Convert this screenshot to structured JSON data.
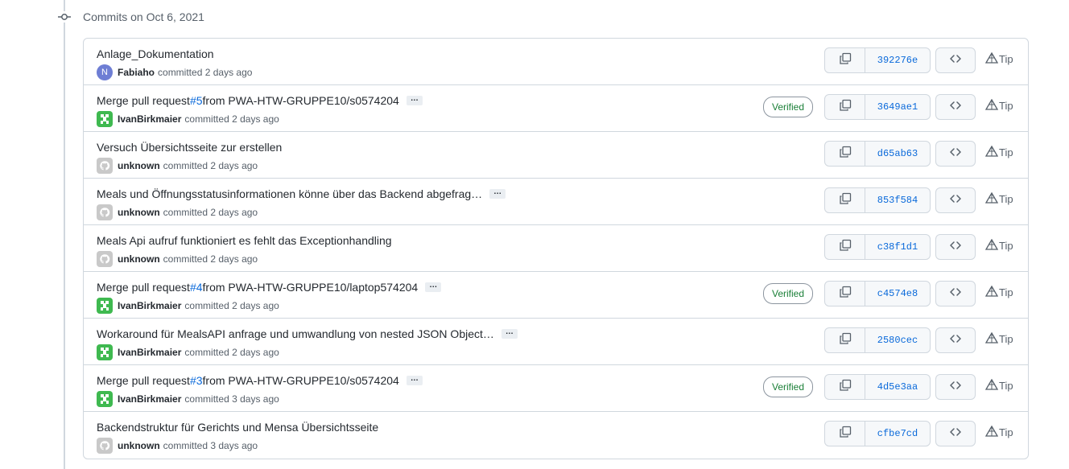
{
  "day_header": "Commits on Oct 6, 2021",
  "tip_label": "Tip",
  "verified_label": "Verified",
  "committed_word": "committed",
  "colors": {
    "link": "#0969da",
    "verified": "#1a7f37",
    "border": "#d0d7de"
  },
  "commits": [
    {
      "title": "Anlage_Dokumentation",
      "pr": null,
      "suffix": "",
      "more": false,
      "author": "Fabiaho",
      "avatar": "letter",
      "avatar_letter": "N",
      "time": "2 days ago",
      "verified": false,
      "sha": "392276e"
    },
    {
      "title": "Merge pull request ",
      "pr": "#5",
      "suffix": " from PWA-HTW-GRUPPE10/s0574204",
      "more": true,
      "author": "IvanBirkmaier",
      "avatar": "green",
      "time": "2 days ago",
      "verified": true,
      "sha": "3649ae1"
    },
    {
      "title": "Versuch Übersichtsseite zur erstellen",
      "pr": null,
      "suffix": "",
      "more": false,
      "author": "unknown",
      "avatar": "gray",
      "time": "2 days ago",
      "verified": false,
      "sha": "d65ab63"
    },
    {
      "title": "Meals und Öffnungsstatusinformationen könne über das Backend abgefrag…",
      "pr": null,
      "suffix": "",
      "more": true,
      "author": "unknown",
      "avatar": "gray",
      "time": "2 days ago",
      "verified": false,
      "sha": "853f584"
    },
    {
      "title": "Meals Api aufruf funktioniert es fehlt das Exceptionhandling",
      "pr": null,
      "suffix": "",
      "more": false,
      "author": "unknown",
      "avatar": "gray",
      "time": "2 days ago",
      "verified": false,
      "sha": "c38f1d1"
    },
    {
      "title": "Merge pull request ",
      "pr": "#4",
      "suffix": " from PWA-HTW-GRUPPE10/laptop574204",
      "more": true,
      "author": "IvanBirkmaier",
      "avatar": "green",
      "time": "2 days ago",
      "verified": true,
      "sha": "c4574e8"
    },
    {
      "title": "Workaround für MealsAPI anfrage und umwandlung von nested JSON Object…",
      "pr": null,
      "suffix": "",
      "more": true,
      "author": "IvanBirkmaier",
      "avatar": "green",
      "time": "2 days ago",
      "verified": false,
      "sha": "2580cec"
    },
    {
      "title": "Merge pull request ",
      "pr": "#3",
      "suffix": " from PWA-HTW-GRUPPE10/s0574204",
      "more": true,
      "author": "IvanBirkmaier",
      "avatar": "green",
      "time": "3 days ago",
      "verified": true,
      "sha": "4d5e3aa"
    },
    {
      "title": "Backendstruktur für Gerichts und Mensa Übersichtsseite",
      "pr": null,
      "suffix": "",
      "more": false,
      "author": "unknown",
      "avatar": "gray",
      "time": "3 days ago",
      "verified": false,
      "sha": "cfbe7cd"
    }
  ]
}
